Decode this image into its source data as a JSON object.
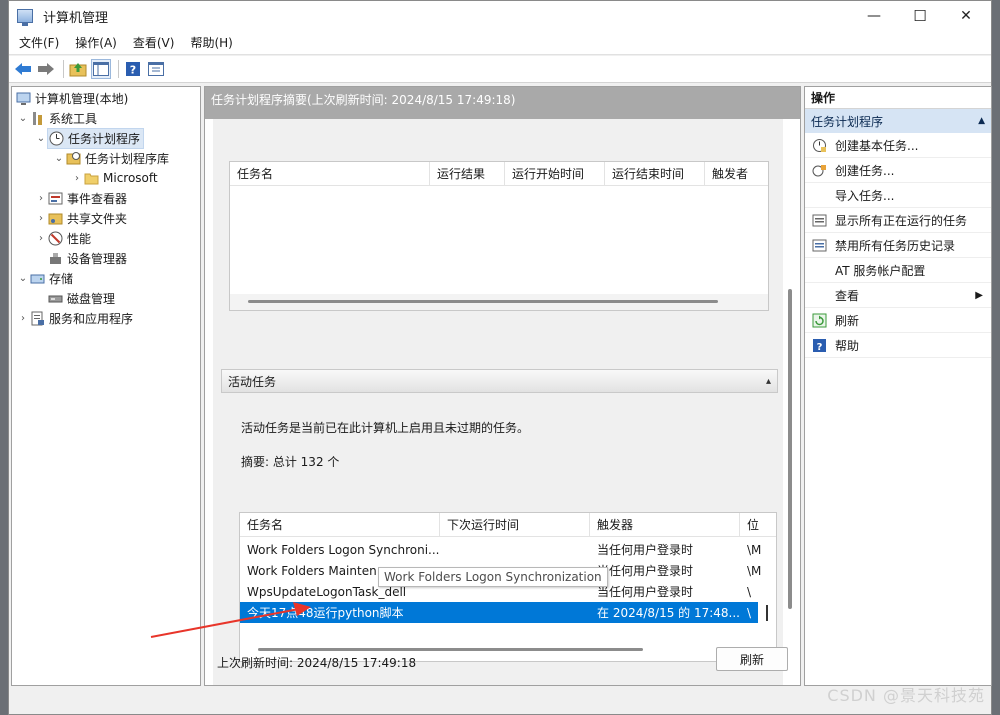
{
  "window": {
    "title": "计算机管理",
    "minimize": "—",
    "maximize": "☐",
    "close": "✕"
  },
  "menu": [
    "文件(F)",
    "操作(A)",
    "查看(V)",
    "帮助(H)"
  ],
  "toolbar_icons": [
    "back-arrow-icon",
    "forward-arrow-icon",
    "up-folder-icon",
    "show-hide-tree-icon",
    "help-icon",
    "properties-icon"
  ],
  "tree": {
    "root": "计算机管理(本地)",
    "system_tools": "系统工具",
    "task_scheduler": "任务计划程序",
    "task_library": "任务计划程序库",
    "microsoft": "Microsoft",
    "event_viewer": "事件查看器",
    "shared_folders": "共享文件夹",
    "performance": "性能",
    "device_manager": "设备管理器",
    "storage": "存储",
    "disk_management": "磁盘管理",
    "services_apps": "服务和应用程序"
  },
  "center": {
    "header": "任务计划程序摘要(上次刷新时间: 2024/8/15 17:49:18)",
    "top_grid_headers": [
      "任务名",
      "运行结果",
      "运行开始时间",
      "运行结束时间",
      "触发者"
    ],
    "section_title": "活动任务",
    "section_collapse": "▴",
    "description": "活动任务是当前已在此计算机上启用且未过期的任务。",
    "summary": "摘要: 总计 132 个",
    "active_headers": [
      "任务名",
      "下次运行时间",
      "触发器",
      "位"
    ],
    "active_rows": [
      {
        "name": "Work Folders Logon Synchroni...",
        "next": "",
        "trigger": "当任何用户登录时",
        "loc": "\\M"
      },
      {
        "name": "Work Folders Mainten",
        "next": "",
        "trigger": "当任何用户登录时",
        "loc": "\\M"
      },
      {
        "name": "WpsUpdateLogonTask_dell",
        "next": "",
        "trigger": "当任何用户登录时",
        "loc": "\\"
      },
      {
        "name": "今天17点48运行python脚本",
        "next": "",
        "trigger": "在 2024/8/15 的 17:48...",
        "loc": "\\"
      }
    ],
    "tooltip": "Work Folders Logon Synchronization",
    "last_refresh": "上次刷新时间: 2024/8/15 17:49:18",
    "refresh_button": "刷新"
  },
  "actions": {
    "title": "操作",
    "subheader": "任务计划程序",
    "items": [
      "创建基本任务...",
      "创建任务...",
      "导入任务...",
      "显示所有正在运行的任务",
      "禁用所有任务历史记录",
      "AT 服务帐户配置",
      "查看",
      "刷新",
      "帮助"
    ]
  },
  "watermark": "CSDN @景天科技苑",
  "colors": {
    "selection": "#0078d7",
    "header_gray": "#a9a9a9",
    "action_sub": "#d6e4f4",
    "arrow": "#e8352a"
  }
}
